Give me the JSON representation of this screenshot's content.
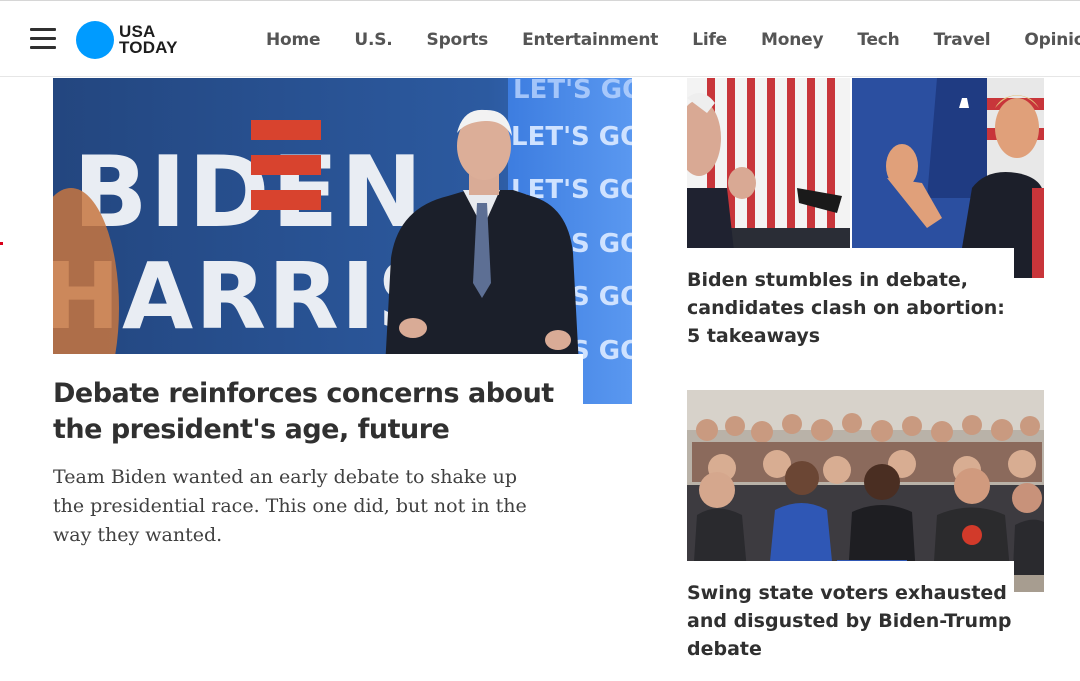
{
  "header": {
    "logo_line1": "USA",
    "logo_line2": "TODAY",
    "nav": [
      "Home",
      "U.S.",
      "Sports",
      "Entertainment",
      "Life",
      "Money",
      "Tech",
      "Travel",
      "Opinio"
    ]
  },
  "hero": {
    "image_sign_line1": "BIDEN",
    "image_sign_line2": "HARRIS",
    "image_banner": "LET'S GO",
    "title": "Debate reinforces concerns about the president's age, future",
    "description": "Team Biden wanted an early debate to shake up the presidential race. This one did, but not in the way they wanted."
  },
  "cards": [
    {
      "title": "Biden stumbles in debate, candidates clash on abortion: 5 takeaways"
    },
    {
      "title": "Swing state voters exhausted and disgusted by Biden-Trump debate"
    }
  ],
  "colors": {
    "brand_blue": "#009bff",
    "text": "#303030",
    "nav_text": "#555555"
  }
}
